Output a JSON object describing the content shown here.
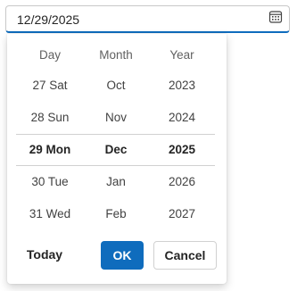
{
  "date_field": {
    "value": "12/29/2025",
    "icon": "calendar-icon"
  },
  "picker": {
    "headers": {
      "day": "Day",
      "month": "Month",
      "year": "Year"
    },
    "rows": [
      {
        "day": "27 Sat",
        "month": "Oct",
        "year": "2023"
      },
      {
        "day": "28 Sun",
        "month": "Nov",
        "year": "2024"
      },
      {
        "day": "29 Mon",
        "month": "Dec",
        "year": "2025",
        "selected": true
      },
      {
        "day": "30 Tue",
        "month": "Jan",
        "year": "2026"
      },
      {
        "day": "31 Wed",
        "month": "Feb",
        "year": "2027"
      }
    ],
    "buttons": {
      "today": "Today",
      "ok": "OK",
      "cancel": "Cancel"
    }
  },
  "colors": {
    "accent": "#0f6cbd",
    "border": "#c8c8c8",
    "divider": "#d1d1d1"
  }
}
